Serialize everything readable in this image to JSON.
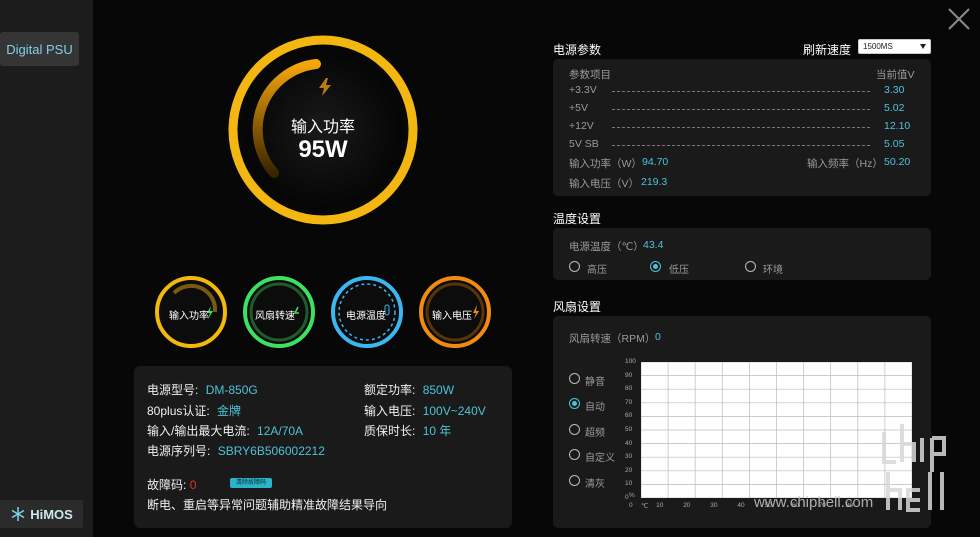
{
  "sidebar": {
    "nav_label": "Digital PSU",
    "logo_text": "HiMOS"
  },
  "main_gauge": {
    "label": "输入功率",
    "value": "95W"
  },
  "small_gauges": [
    {
      "label": "输入功率",
      "color": "#f2b90c"
    },
    {
      "label": "风扇转速",
      "color": "#3de061"
    },
    {
      "label": "电源温度",
      "color": "#3cb6f0"
    },
    {
      "label": "输入电压",
      "color": "#f08a10"
    }
  ],
  "info": {
    "model_label": "电源型号:",
    "model_value": "DM-850G",
    "rated_label": "额定功率:",
    "rated_value": "850W",
    "cert_label": "80plus认证:",
    "cert_value": "金牌",
    "input_v_label": "输入电压:",
    "input_v_value": "100V~240V",
    "max_current_label": "输入/输出最大电流:",
    "max_current_value": "12A/70A",
    "warranty_label": "质保时长:",
    "warranty_value": "10 年",
    "serial_label": "电源序列号:",
    "serial_value": "SBRY6B506002212",
    "fault_label": "故障码:",
    "fault_value": "0",
    "clear_button": "清除故障码",
    "fault_note": "断电、重启等异常问题辅助精准故障结果导向"
  },
  "power_params": {
    "title": "电源参数",
    "refresh_label": "刷新速度",
    "refresh_value": "1500MS",
    "col_item": "参数项目",
    "col_value": "当前值V",
    "rows": [
      {
        "name": "+3.3V",
        "value": "3.30"
      },
      {
        "name": "+5V",
        "value": "5.02"
      },
      {
        "name": "+12V",
        "value": "12.10"
      },
      {
        "name": "5V SB",
        "value": "5.05"
      }
    ],
    "input_power_label": "输入功率（W）",
    "input_power_value": "94.70",
    "input_freq_label": "输入频率（Hz）",
    "input_freq_value": "50.20",
    "input_volt_label": "输入电压（V）",
    "input_volt_value": "219.3"
  },
  "temperature": {
    "title": "温度设置",
    "temp_label": "电源温度（℃）",
    "temp_value": "43.4",
    "options": [
      "高压",
      "低压",
      "环境"
    ],
    "selected": 1
  },
  "fan": {
    "title": "风扇设置",
    "speed_label": "风扇转速（RPM）",
    "speed_value": "0",
    "modes": [
      "静音",
      "自动",
      "超频",
      "自定义",
      "清灰"
    ],
    "selected": 1
  },
  "chart_data": {
    "type": "line",
    "x_ticks": [
      "0",
      "10",
      "20",
      "30",
      "40",
      "50",
      "60",
      "70",
      "80"
    ],
    "x_unit": "℃",
    "y_ticks": [
      "100",
      "90",
      "80",
      "70",
      "60",
      "50",
      "40",
      "30",
      "20",
      "10",
      "0"
    ],
    "y_unit": "%",
    "xlim": [
      0,
      100
    ],
    "ylim": [
      0,
      100
    ],
    "grid": true,
    "series": []
  },
  "watermark": {
    "text": "www.chiphell.com",
    "logo": "chip hell"
  }
}
